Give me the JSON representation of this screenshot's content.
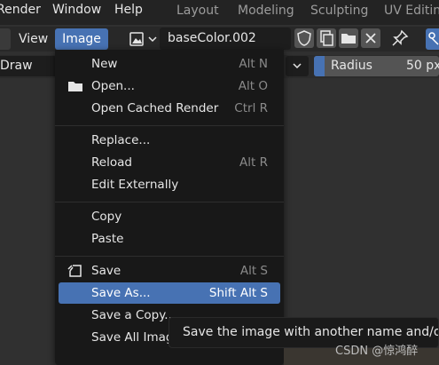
{
  "topbar": {
    "menus": [
      "Render",
      "Window",
      "Help"
    ],
    "workspaces": [
      "Layout",
      "Modeling",
      "Sculpting",
      "UV Editing"
    ]
  },
  "header": {
    "view_label": "View",
    "image_label": "Image",
    "image_name": "baseColor.002"
  },
  "toolbar": {
    "mode": "Draw",
    "radius_label": "Radius",
    "radius_value": "50 px"
  },
  "menu": {
    "items": [
      {
        "label": "New",
        "shortcut": "Alt N",
        "icon": ""
      },
      {
        "label": "Open...",
        "shortcut": "Alt O",
        "icon": "folder-icon"
      },
      {
        "label": "Open Cached Render",
        "shortcut": "Ctrl R",
        "icon": ""
      },
      {
        "label": "Replace...",
        "shortcut": "",
        "icon": ""
      },
      {
        "label": "Reload",
        "shortcut": "Alt R",
        "icon": ""
      },
      {
        "label": "Edit Externally",
        "shortcut": "",
        "icon": ""
      },
      {
        "label": "Copy",
        "shortcut": "",
        "icon": ""
      },
      {
        "label": "Paste",
        "shortcut": "",
        "icon": ""
      },
      {
        "label": "Save",
        "shortcut": "Alt S",
        "icon": "save-icon"
      },
      {
        "label": "Save As...",
        "shortcut": "Shift Alt S",
        "icon": ""
      },
      {
        "label": "Save a Copy...",
        "shortcut": "",
        "icon": ""
      },
      {
        "label": "Save All Images",
        "shortcut": "",
        "icon": ""
      }
    ],
    "highlighted": "Save As..."
  },
  "tooltip": {
    "text": "Save the image with another name and/or settings"
  },
  "watermark": "CSDN @惊鸿醉",
  "colors": {
    "accent": "#4772b3",
    "menu_bg": "#181818",
    "background": "#303030"
  }
}
